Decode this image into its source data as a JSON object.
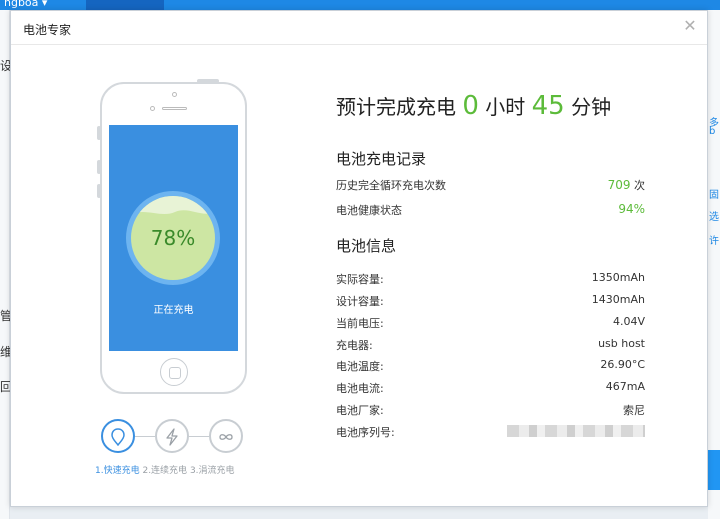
{
  "background": {
    "account_label": "ngboa ▾",
    "left_fragments": [
      "设",
      "管",
      "维",
      "回"
    ],
    "right_fragments": [
      "多",
      "b",
      "固",
      "选",
      "许"
    ]
  },
  "dialog": {
    "title": "电池专家",
    "close_icon": "close-icon"
  },
  "phone": {
    "battery_percent": "78%",
    "battery_level": 0.78,
    "status": "正在充电"
  },
  "steps": [
    {
      "label": "1.快速充电",
      "icon": "shield-icon",
      "active": true
    },
    {
      "label": "2.连续充电",
      "icon": "lightning-icon",
      "active": false
    },
    {
      "label": "3.涓流充电",
      "icon": "infinity-icon",
      "active": false
    }
  ],
  "estimate": {
    "prefix": "预计完成充电",
    "hours": "0",
    "hours_unit": "小时",
    "minutes": "45",
    "minutes_unit": "分钟"
  },
  "charge_record": {
    "title": "电池充电记录",
    "cycles_label": "历史完全循环充电次数",
    "cycles_value": "709",
    "cycles_unit": "次",
    "health_label": "电池健康状态",
    "health_value": "94%"
  },
  "battery_info": {
    "title": "电池信息",
    "rows": [
      {
        "label": "实际容量:",
        "value": "1350mAh"
      },
      {
        "label": "设计容量:",
        "value": "1430mAh"
      },
      {
        "label": "当前电压:",
        "value": "4.04V"
      },
      {
        "label": "充电器:",
        "value": "usb host"
      },
      {
        "label": "电池温度:",
        "value": "26.90°C"
      },
      {
        "label": "电池电流:",
        "value": "467mA"
      },
      {
        "label": "电池厂家:",
        "value": "索尼"
      }
    ],
    "serial_label": "电池序列号:"
  },
  "colors": {
    "accent_blue": "#3a8fe0",
    "accent_green": "#5cbb3a"
  }
}
